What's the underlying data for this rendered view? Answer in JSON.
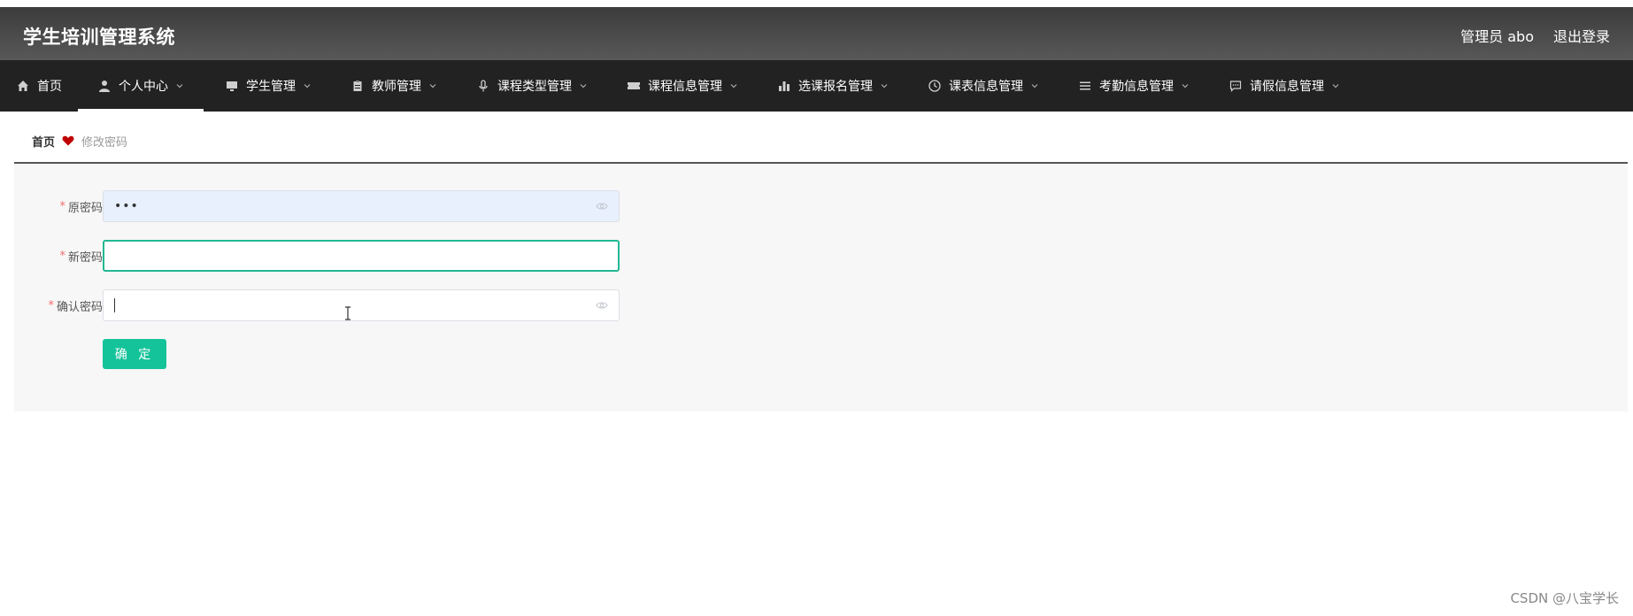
{
  "header": {
    "title": "学生培训管理系统",
    "user_label": "管理员 abo",
    "logout_label": "退出登录"
  },
  "nav": {
    "items": [
      {
        "label": "首页",
        "icon": "home-icon",
        "has_dropdown": false
      },
      {
        "label": "个人中心",
        "icon": "user-icon",
        "has_dropdown": true,
        "active": true
      },
      {
        "label": "学生管理",
        "icon": "monitor-icon",
        "has_dropdown": true
      },
      {
        "label": "教师管理",
        "icon": "clipboard-icon",
        "has_dropdown": true
      },
      {
        "label": "课程类型管理",
        "icon": "microphone-icon",
        "has_dropdown": true
      },
      {
        "label": "课程信息管理",
        "icon": "ticket-icon",
        "has_dropdown": true
      },
      {
        "label": "选课报名管理",
        "icon": "bar-chart-icon",
        "has_dropdown": true
      },
      {
        "label": "课表信息管理",
        "icon": "clock-icon",
        "has_dropdown": true
      },
      {
        "label": "考勤信息管理",
        "icon": "list-icon",
        "has_dropdown": true
      },
      {
        "label": "请假信息管理",
        "icon": "chat-icon",
        "has_dropdown": true
      }
    ]
  },
  "breadcrumb": {
    "home": "首页",
    "current": "修改密码"
  },
  "form": {
    "old_password": {
      "label": "原密码",
      "value": "•••"
    },
    "new_password": {
      "label": "新密码",
      "value": ""
    },
    "confirm_password": {
      "label": "确认密码",
      "value": ""
    },
    "submit_label": "确 定"
  },
  "watermark": "CSDN @八宝学长",
  "colors": {
    "accent": "#15c39a",
    "focus_border": "#23b894",
    "header_bg": "#4a4a4a",
    "nav_bg": "#222222",
    "heart": "#c00000"
  }
}
